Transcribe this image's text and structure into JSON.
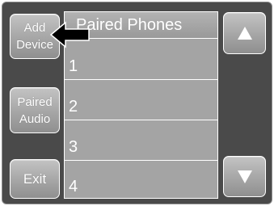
{
  "side_buttons": {
    "add_device": {
      "line1": "Add",
      "line2": "Device"
    },
    "paired_audio": {
      "line1": "Paired",
      "line2": "Audio"
    },
    "exit": "Exit"
  },
  "list": {
    "title": "Paired Phones",
    "rows": [
      "1",
      "2",
      "3",
      "4"
    ]
  },
  "scroll": {
    "up_icon": "up-triangle-icon",
    "down_icon": "down-triangle-icon"
  },
  "annotation": {
    "icon": "pointing-arrow-icon"
  },
  "colors": {
    "panel": "#4a4a4a",
    "button": "#a7a7a7",
    "list": "#a4a4a4",
    "text": "#ffffff",
    "arrow": "#000000"
  }
}
